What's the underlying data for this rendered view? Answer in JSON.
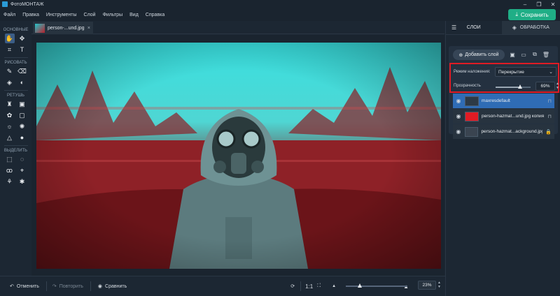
{
  "app": {
    "title": "ФотоМОНТАЖ"
  },
  "window_controls": [
    {
      "name": "minimize-button",
      "glyph": "–"
    },
    {
      "name": "restore-button",
      "glyph": "❐"
    },
    {
      "name": "close-button",
      "glyph": "✕"
    }
  ],
  "menu": [
    "Файл",
    "Правка",
    "Инструменты",
    "Слой",
    "Фильтры",
    "Вид",
    "Справка"
  ],
  "save_button": {
    "label": "Сохранить",
    "color": "#1fae86"
  },
  "toolbar": {
    "sections": [
      {
        "label": "ОСНОВНЫЕ",
        "tools": [
          [
            "hand-icon",
            "✋"
          ],
          [
            "move-icon",
            "✥"
          ],
          [
            "crop-icon",
            "⌗"
          ],
          [
            "text-icon",
            "T"
          ]
        ]
      },
      {
        "label": "РИСОВАТЬ",
        "tools": [
          [
            "brush-icon",
            "✎"
          ],
          [
            "eraser-icon",
            "⌫"
          ],
          [
            "fill-icon",
            "◈"
          ],
          [
            "gradient-icon",
            "◐"
          ]
        ]
      },
      {
        "label": "РЕТУШЬ",
        "tools": [
          [
            "stamp-icon",
            "♜"
          ],
          [
            "patch-icon",
            "▣"
          ],
          [
            "healing-icon",
            "✿"
          ],
          [
            "frame-icon",
            "▢"
          ],
          [
            "dodge-icon",
            "☼"
          ],
          [
            "burn-icon",
            "✺"
          ],
          [
            "sharpen-icon",
            "△"
          ],
          [
            "blur-icon",
            "●"
          ]
        ]
      },
      {
        "label": "ВЫДЕЛИТЬ",
        "tools": [
          [
            "rect-select-icon",
            "⬚"
          ],
          [
            "ellipse-select-icon",
            "◌"
          ],
          [
            "lasso-icon",
            "ꝏ"
          ],
          [
            "poly-lasso-icon",
            "⌖"
          ],
          [
            "magic-brush-icon",
            "⚘"
          ],
          [
            "magic-wand-icon",
            "✱"
          ]
        ]
      }
    ]
  },
  "document_tab": {
    "name": "person-...und.jpg",
    "close": "×"
  },
  "bottom": {
    "undo": "Отменить",
    "redo": "Повторить",
    "compare": "Сравнить",
    "ratio": "1:1",
    "zoom": "23%",
    "zoom_fraction": 0.23
  },
  "right_panel": {
    "tabs": [
      {
        "label": "СЛОИ",
        "selected": true
      },
      {
        "label": "ОБРАБОТКА",
        "selected": false
      }
    ],
    "add_layer": "Добавить слой",
    "blend_label": "Режим наложения:",
    "blend_mode": "Перекрытие",
    "opacity_label": "Прозрачность",
    "opacity": "69%",
    "opacity_fraction": 0.69,
    "layers": [
      {
        "name": "maxresdefault",
        "selected": true,
        "thumb": "#2d3a46"
      },
      {
        "name": "person-hazmat...und.jpg копия",
        "selected": false,
        "thumb": "#e01b24"
      },
      {
        "name": "person-hazmat...ackground.jpg",
        "selected": false,
        "thumb": "#3a4450"
      }
    ]
  },
  "colors": {
    "accent": "#1fae86",
    "highlight": "#e01b24",
    "selected_layer": "#2f6cb5"
  }
}
